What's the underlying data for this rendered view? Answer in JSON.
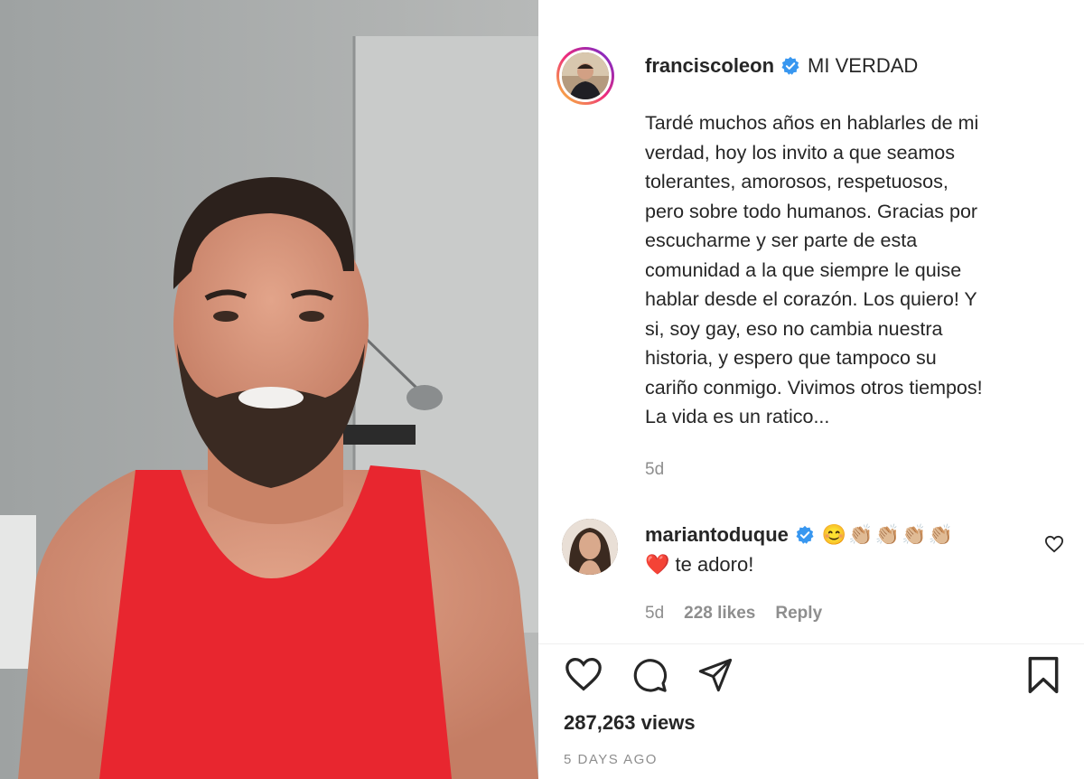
{
  "post": {
    "author": {
      "username": "franciscoleon",
      "verified": true
    },
    "title": "MI VERDAD",
    "caption": "Tardé muchos años en hablarles de mi\nverdad, hoy los invito a que seamos\ntolerantes, amorosos, respetuosos,\npero sobre todo humanos. Gracias por\nescucharme y ser parte de esta\ncomunidad a la que siempre le quise\nhablar desde el corazón. Los quiero! Y\nsi, soy gay, eso no cambia nuestra\nhistoria, y espero que tampoco su\ncariño conmigo. Vivimos otros tiempos!\nLa vida es un ratico...",
    "age": "5d"
  },
  "comments": [
    {
      "username": "mariantoduque",
      "verified": true,
      "emoji_line": "😊👏🏼👏🏼👏🏼👏🏼",
      "text": "❤️ te adoro!",
      "age": "5d",
      "likes": "228 likes",
      "reply_label": "Reply"
    }
  ],
  "actions": {
    "icons": [
      "heart-icon",
      "comment-icon",
      "share-icon",
      "bookmark-icon"
    ]
  },
  "stats": {
    "views": "287,263 views",
    "posted": "5 DAYS AGO"
  },
  "colors": {
    "verified": "#3897f0",
    "text": "#262626",
    "muted": "#8e8e8e",
    "tank_top": "#e8262f"
  }
}
